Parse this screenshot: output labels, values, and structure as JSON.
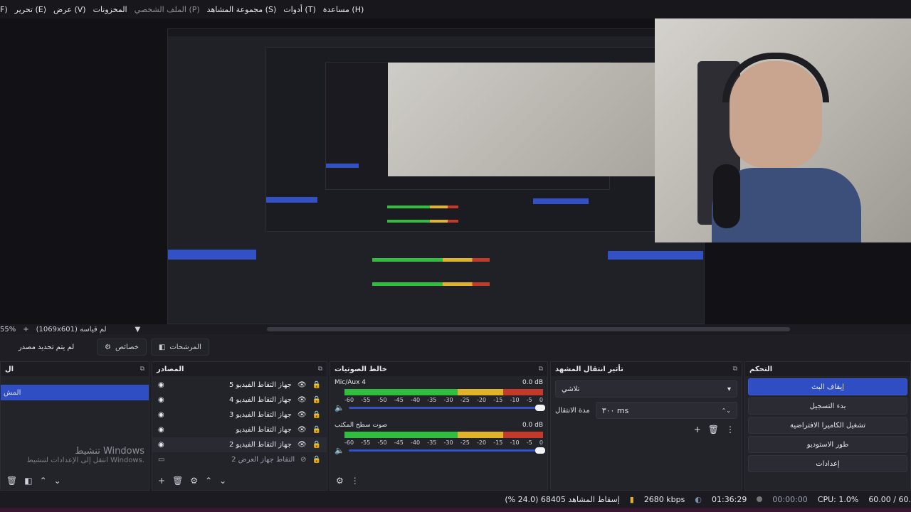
{
  "menu": [
    "(H) مساعدة",
    "(T) أدوات",
    "(S) مجموعة المشاهد",
    "(P) الملف الشخصي",
    "المخزونات",
    "(V) عرض",
    "(E) تحرير",
    "(F"
  ],
  "zoom": {
    "percent": "55%",
    "size_label": "(1069x601) لم قياسه"
  },
  "tabs": {
    "no_source": "لم يتم تحديد مصدر",
    "properties": "خصائص",
    "filters": "المرشحات"
  },
  "docks": {
    "scenes": {
      "title": "ال",
      "selected_item": "المش"
    },
    "sources": {
      "title": "المصادر",
      "rows": [
        {
          "label": "جهاز التقاط الفيديو 5",
          "selected": false
        },
        {
          "label": "جهاز التقاط الفيديو 4",
          "selected": false
        },
        {
          "label": "جهاز التقاط الفيديو 3",
          "selected": false
        },
        {
          "label": "جهاز التقاط الفيديو",
          "selected": false
        },
        {
          "label": "جهاز التقاط الفيديو 2",
          "selected": true
        },
        {
          "label": "التقاط جهاز العرض 2",
          "selected": false
        }
      ],
      "watermark_title": "تنشيط Windows",
      "watermark_sub": "انتقل إلى الإعدادات لتنشيط Windows."
    },
    "mixer": {
      "title": "خالط الصوتيات",
      "channels": [
        {
          "name": "Mic/Aux 4",
          "db": "0.0 dB"
        },
        {
          "name": "صوت سطح المكتب",
          "db": "0.0 dB"
        }
      ],
      "ticks": [
        "-60",
        "-55",
        "-50",
        "-45",
        "-40",
        "-35",
        "-30",
        "-25",
        "-20",
        "-15",
        "-10",
        "-5",
        "0"
      ]
    },
    "transition": {
      "title": "تأثير انتقال المشهد",
      "type": "تلاشي",
      "duration_label": "مدة الانتقال",
      "duration_value": "٣٠٠ ms"
    },
    "controls": {
      "title": "التحكم",
      "buttons": [
        "إيقاف البث",
        "بدء التسجيل",
        "تشغيل الكاميرا الافتراضية",
        "طور الاستوديو",
        "إعدادات"
      ]
    }
  },
  "status": {
    "dropped": "إسقاط المشاهد 68405 (24.0 %)",
    "bitrate": "2680 kbps",
    "stream_time": "01:36:29",
    "rec_time": "00:00:00",
    "cpu": "CPU: 1.0%",
    "fps": "60.00 / 60."
  },
  "colors": {
    "accent": "#2f4ec4",
    "panel": "#23232a",
    "background": "#1e1e24"
  }
}
